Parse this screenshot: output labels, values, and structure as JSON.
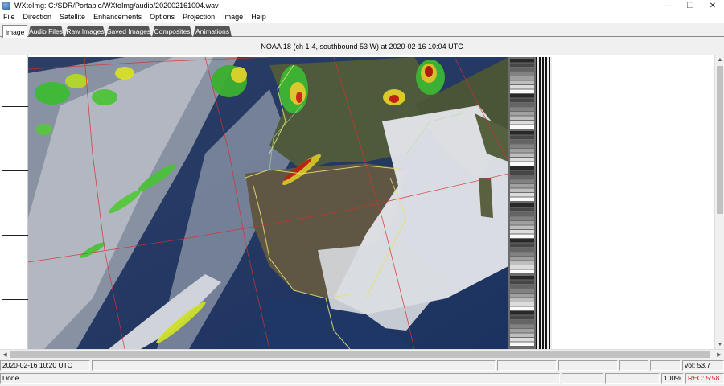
{
  "window": {
    "title": "WXtoImg: C:/SDR/Portable/WXtoImg/audio/20200216100​4.wav",
    "controls": [
      "—",
      "❐",
      "✕"
    ]
  },
  "menu": [
    "File",
    "Direction",
    "Satellite",
    "Enhancements",
    "Options",
    "Projection",
    "Image",
    "Help"
  ],
  "tabs": [
    "Image",
    "Audio Files",
    "Raw Images",
    "Saved Images",
    "Composites",
    "Animations"
  ],
  "image_caption": "NOAA 18 (ch 1-4, southbound 53 W) at 2020-02-16  10:04 UTC",
  "status": {
    "time": "2020-02-16  10:20 UTC",
    "vol": "vol: 53.7",
    "message": "Done.",
    "zoom": "100%",
    "rec": "REC: 5:58"
  },
  "colors": {
    "rec": "#d02020",
    "ocean": "#1f3a6b",
    "land": "#5a5040",
    "grid": "#d63030",
    "coast": "#e8e060"
  }
}
